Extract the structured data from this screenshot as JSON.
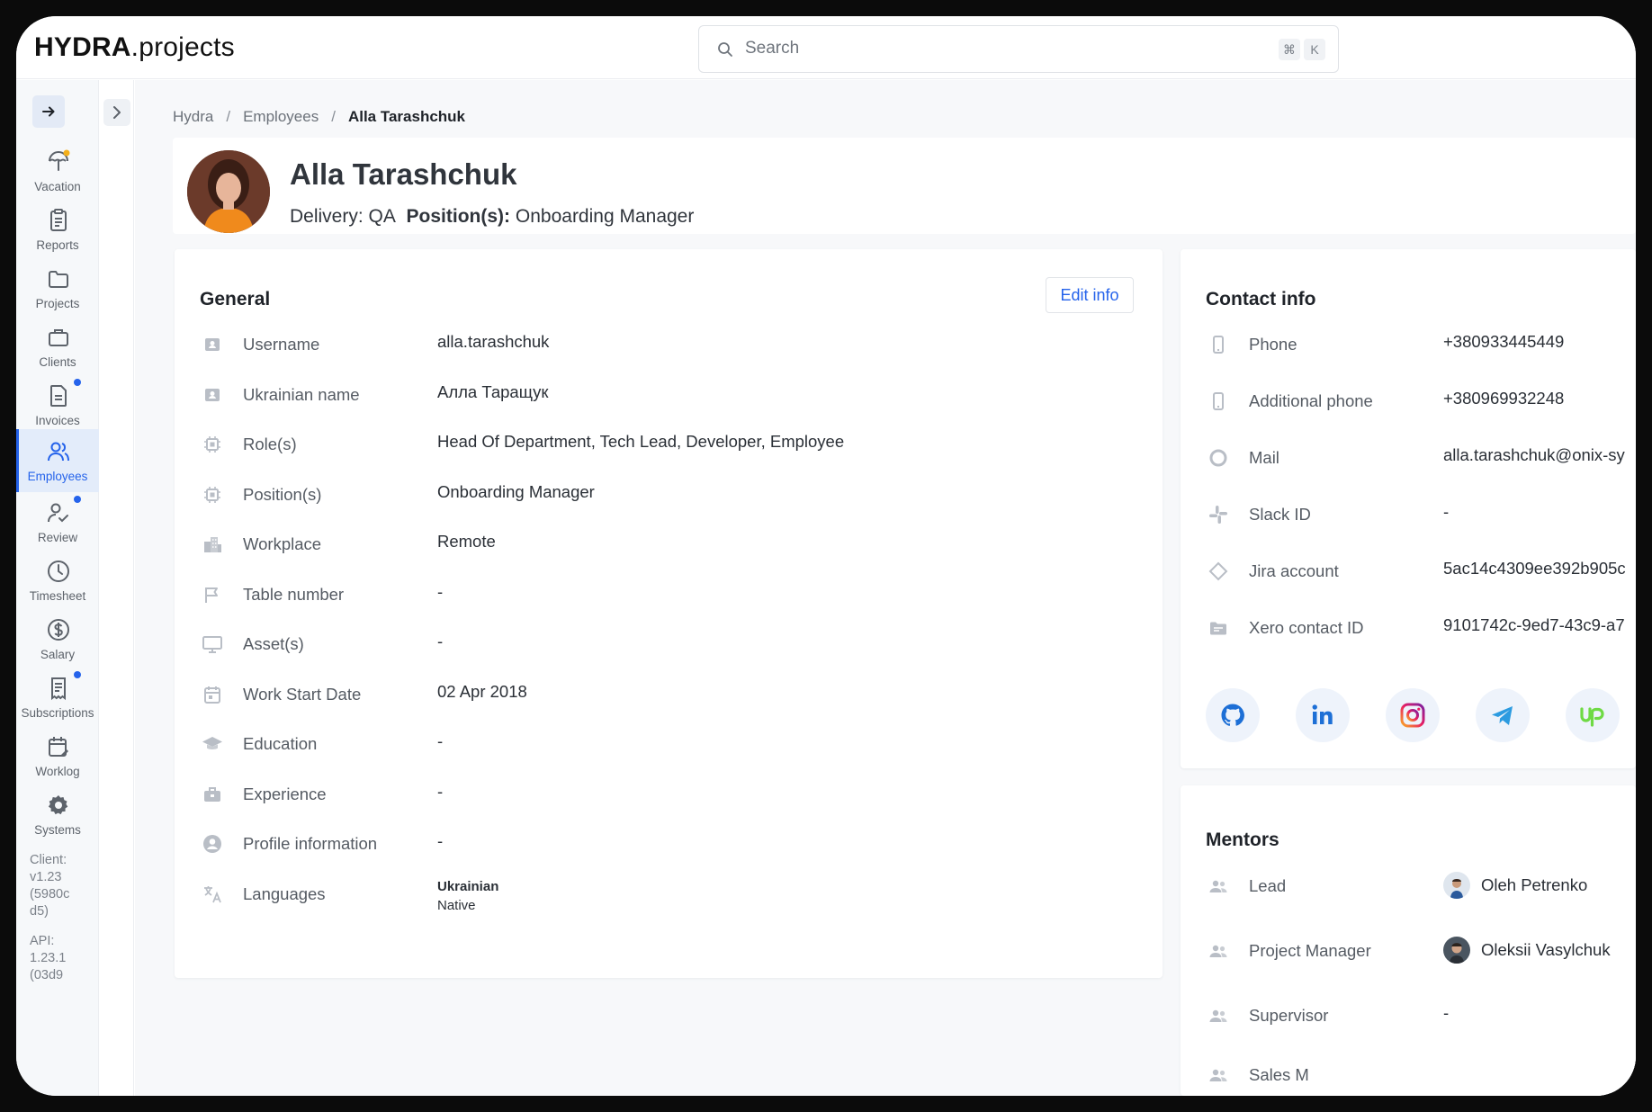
{
  "app": {
    "logo_bold": "HYDRA",
    "logo_rest": ".projects"
  },
  "search": {
    "placeholder": "Search",
    "shortcut_1": "⌘",
    "shortcut_2": "K"
  },
  "sidebar": {
    "items": [
      {
        "label": "Vacation",
        "icon": "umbrella-icon"
      },
      {
        "label": "Reports",
        "icon": "clipboard-icon"
      },
      {
        "label": "Projects",
        "icon": "folder-icon"
      },
      {
        "label": "Clients",
        "icon": "briefcase-icon"
      },
      {
        "label": "Invoices",
        "icon": "document-icon",
        "badge": true
      },
      {
        "label": "Employees",
        "icon": "users-icon",
        "active": true
      },
      {
        "label": "Review",
        "icon": "user-check-icon",
        "badge": true
      },
      {
        "label": "Timesheet",
        "icon": "clock-icon"
      },
      {
        "label": "Salary",
        "icon": "dollar-icon"
      },
      {
        "label": "Subscriptions",
        "icon": "receipt-icon",
        "badge": true
      },
      {
        "label": "Worklog",
        "icon": "calendar-edit-icon"
      },
      {
        "label": "Systems",
        "icon": "gear-icon"
      }
    ],
    "client_version": "Client:\nv1.23\n(5980c\nd5)",
    "api_version": "API:\n1.23.1\n(03d9"
  },
  "breadcrumb": {
    "root": "Hydra",
    "section": "Employees",
    "current": "Alla Tarashchuk"
  },
  "profile": {
    "name": "Alla Tarashchuk",
    "delivery_label": "Delivery:",
    "delivery_value": "QA",
    "position_label": "Position(s):",
    "position_value": "Onboarding Manager"
  },
  "general": {
    "title": "General",
    "edit_label": "Edit info",
    "rows": [
      {
        "label": "Username",
        "value": "alla.tarashchuk"
      },
      {
        "label": "Ukrainian name",
        "value": "Алла Таращук"
      },
      {
        "label": "Role(s)",
        "value": "Head Of Department, Tech Lead, Developer, Employee"
      },
      {
        "label": "Position(s)",
        "value": "Onboarding Manager"
      },
      {
        "label": "Workplace",
        "value": "Remote"
      },
      {
        "label": "Table number",
        "value": "-"
      },
      {
        "label": "Asset(s)",
        "value": "-"
      },
      {
        "label": "Work Start Date",
        "value": "02 Apr 2018"
      },
      {
        "label": "Education",
        "value": "-"
      },
      {
        "label": "Experience",
        "value": "-"
      },
      {
        "label": "Profile information",
        "value": "-"
      },
      {
        "label": "Languages",
        "value": "Ukrainian",
        "sub": "Native"
      }
    ]
  },
  "contact": {
    "title": "Contact info",
    "rows": [
      {
        "label": "Phone",
        "value": "+380933445449"
      },
      {
        "label": "Additional phone",
        "value": "+380969932248"
      },
      {
        "label": "Mail",
        "value": "alla.tarashchuk@onix-sy"
      },
      {
        "label": "Slack ID",
        "value": "-"
      },
      {
        "label": "Jira account",
        "value": "5ac14c4309ee392b905c"
      },
      {
        "label": "Xero contact ID",
        "value": "9101742c-9ed7-43c9-a7"
      }
    ],
    "socials": [
      "github-icon",
      "linkedin-icon",
      "instagram-icon",
      "telegram-icon",
      "upwork-icon"
    ]
  },
  "mentors": {
    "title": "Mentors",
    "rows": [
      {
        "label": "Lead",
        "value": "Oleh Petrenko"
      },
      {
        "label": "Project Manager",
        "value": "Oleksii Vasylchuk"
      },
      {
        "label": "Supervisor",
        "value": "-"
      },
      {
        "label": "Sales M",
        "value": ""
      }
    ]
  },
  "colors": {
    "accent": "#2563eb",
    "active_bg": "#e3ecfa",
    "sidebar_bg": "#f6f8fa"
  }
}
